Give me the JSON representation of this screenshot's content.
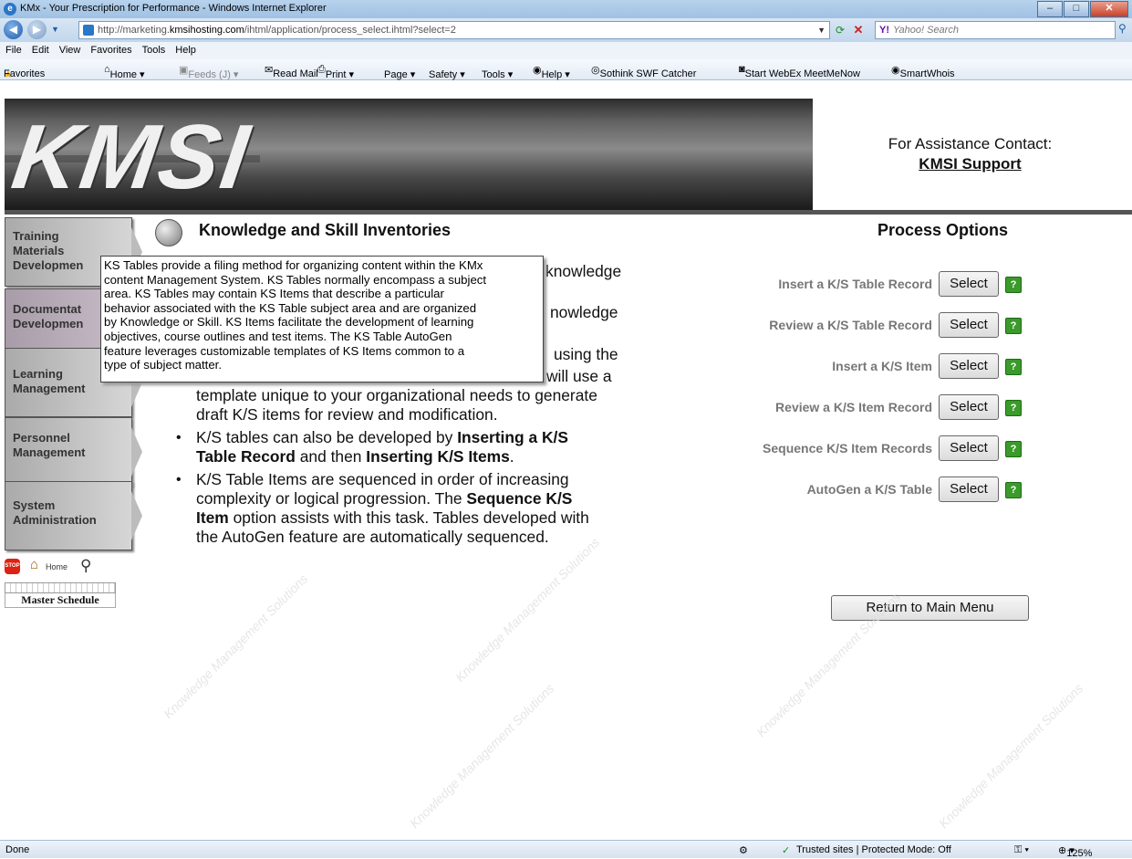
{
  "window": {
    "title": "KMx - Your Prescription for Performance - Windows Internet Explorer"
  },
  "address": {
    "url_prefix": "http://marketing.",
    "url_domain": "kmsihosting.com",
    "url_path": "/ihtml/application/process_select.ihtml?select=2",
    "search_placeholder": "Yahoo! Search"
  },
  "menu": [
    "File",
    "Edit",
    "View",
    "Favorites",
    "Tools",
    "Help"
  ],
  "favbar": {
    "favorites": "Favorites",
    "items": [
      "Home ▾",
      "Feeds (J) ▾",
      "Read Mail",
      "Print ▾",
      "Page ▾",
      "Safety ▾",
      "Tools ▾",
      "Help ▾",
      "Sothink SWF Catcher",
      "Start WebEx MeetMeNow",
      "SmartWhois"
    ]
  },
  "banner": {
    "logo": "KMSI",
    "assist_text": "For Assistance Contact:",
    "support_link": "KMSI Support"
  },
  "sidebar": {
    "tabs": [
      {
        "label1": "Training",
        "label2": "Materials",
        "label3": "Developmen"
      },
      {
        "label1": "Documentat",
        "label2": "Developmen",
        "label3": ""
      },
      {
        "label1": "Learning",
        "label2": "Management",
        "label3": ""
      },
      {
        "label1": "Personnel",
        "label2": "Management",
        "label3": ""
      },
      {
        "label1": "System",
        "label2": "Administration",
        "label3": ""
      }
    ],
    "home_label": "Home",
    "stop_label": "STOP",
    "master_schedule": "Master Schedule"
  },
  "main": {
    "heading": "Knowledge and Skill Inventories",
    "bullet_fragments": {
      "b1_end": "knowledge",
      "b2_end": "nowledge",
      "b3_end1": "using the",
      "b3_end2": "will use a",
      "b3_line3": "template unique to your organizational needs to generate",
      "b3_line4": "draft K/S items for review and modification."
    },
    "bullet4": {
      "l1a": "K/S tables can also be developed by ",
      "l1b": "Inserting a K/S",
      "l2a": "Table Record",
      "l2b": " and then ",
      "l2c": "Inserting K/S Items",
      "l2d": "."
    },
    "bullet5": {
      "l1": "K/S Table Items are sequenced in order of increasing",
      "l2a": "complexity or logical progression. The ",
      "l2b": "Sequence K/S",
      "l3a": "Item",
      "l3b": " option assists with this task. Tables developed with",
      "l4": "the AutoGen feature are automatically sequenced."
    }
  },
  "tooltip": {
    "lines": [
      "KS Tables provide a filing method for organizing content within the KMx",
      "content Management System. KS Tables normally encompass a subject",
      "area. KS Tables may contain KS Items that describe a particular",
      "behavior associated with the KS Table subject area and are organized",
      "by Knowledge or Skill. KS Items facilitate the development of learning",
      "objectives, course outlines and test items. The KS Table AutoGen",
      "feature leverages customizable templates of KS Items common to a",
      "type of subject matter."
    ]
  },
  "process": {
    "title": "Process Options",
    "select_label": "Select",
    "options": [
      "Insert a K/S Table Record",
      "Review a K/S Table Record",
      "Insert a K/S Item",
      "Review a K/S Item Record",
      "Sequence K/S Item Records",
      "AutoGen a K/S Table"
    ],
    "return_label": "Return to Main Menu"
  },
  "statusbar": {
    "left": "Done",
    "zone": "Trusted sites | Protected Mode: Off",
    "zoom": "125%"
  },
  "watermark": "Knowledge Management Solutions"
}
